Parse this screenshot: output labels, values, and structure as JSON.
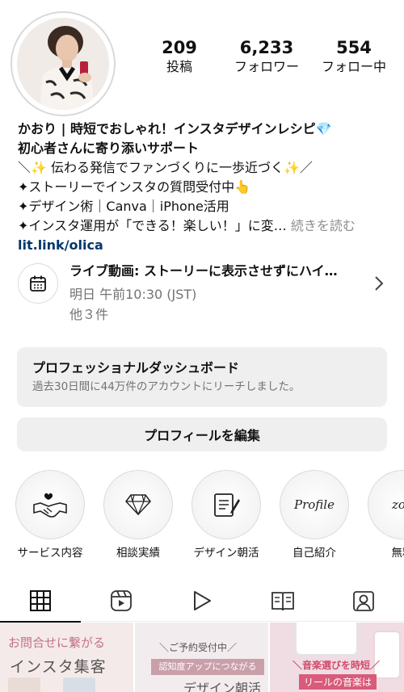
{
  "stats": [
    {
      "count": "209",
      "label": "投稿"
    },
    {
      "count": "6,233",
      "label": "フォロワー"
    },
    {
      "count": "554",
      "label": "フォロー中"
    }
  ],
  "bio": {
    "name_line": "かおり | 時短でおしゃれ！インスタデザインレシピ💎",
    "tagline": "初心者さんに寄り添いサポート",
    "line1": "＼✨ 伝わる発信でファンづくりに一歩近づく✨／",
    "line2": "✦ストーリーでインスタの質問受付中👆",
    "line3": "✦デザイン術｜Canva｜iPhone活用",
    "line4": "✦インスタ運用が「できる！楽しい！」に変…",
    "more": "続きを読む",
    "link": "lit.link/olica"
  },
  "event": {
    "title": "ライブ動画: ストーリーに表示させずにハイ…",
    "time": "明日 午前10:30 (JST)",
    "others": "他３件"
  },
  "dashboard": {
    "title": "プロフェッショナルダッシュボード",
    "subtitle": "過去30日間に44万件のアカウントにリーチしました。"
  },
  "edit_button": "プロフィールを編集",
  "highlights": [
    {
      "label": "サービス内容",
      "icon": "handshake-icon",
      "cover_text": ""
    },
    {
      "label": "相談実績",
      "icon": "diamond-icon",
      "cover_text": ""
    },
    {
      "label": "デザイン朝活",
      "icon": "notepad-icon",
      "cover_text": ""
    },
    {
      "label": "自己紹介",
      "icon": "",
      "cover_text": "Profile"
    },
    {
      "label": "無料",
      "icon": "",
      "cover_text": "zoo"
    }
  ],
  "tabs": [
    "grid-icon",
    "reels-icon",
    "play-icon",
    "guide-icon",
    "tagged-icon"
  ],
  "posts": [
    {
      "line1": "お問合せに繋がる",
      "line2": "インスタ集客"
    },
    {
      "line1": "＼ご予約受付中／",
      "line2": "認知度アップにつながる",
      "line3": "デザイン朝活"
    },
    {
      "line1": "＼音楽選びを時短／",
      "line2": "リールの音楽は"
    }
  ],
  "colors": {
    "text": "#111111",
    "muted": "#737373",
    "link": "#00376b",
    "button_bg": "#efefef"
  }
}
